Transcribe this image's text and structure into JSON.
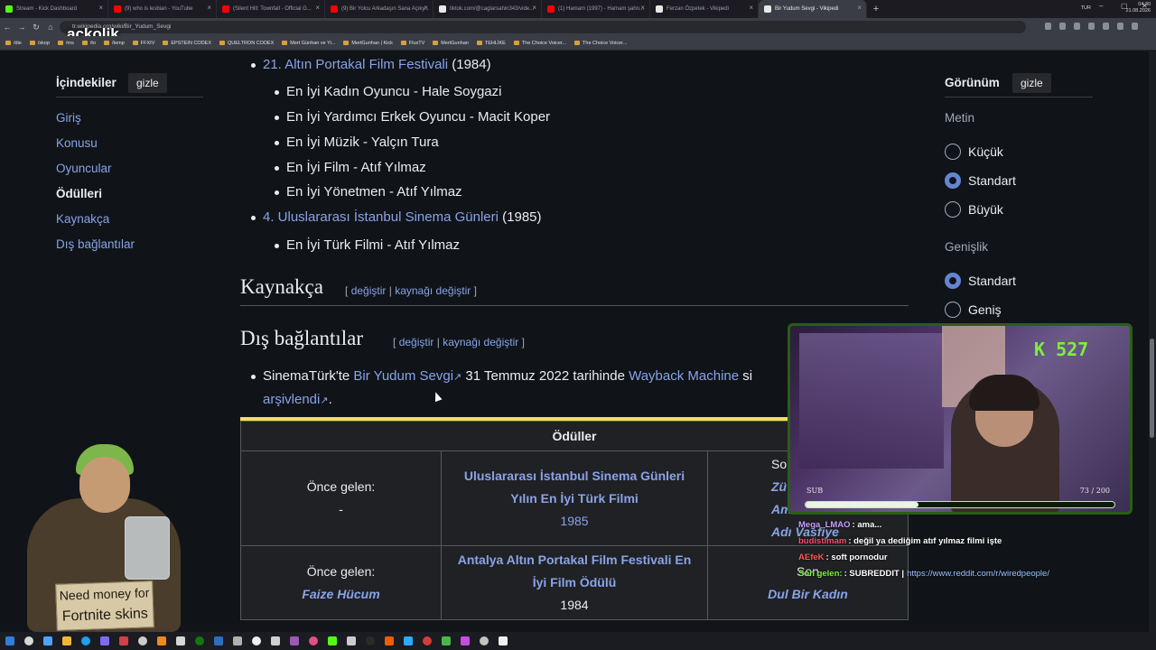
{
  "browser": {
    "tabs": [
      {
        "title": "Stream - Kick Dashboard",
        "color": "#53fc18",
        "active": false
      },
      {
        "title": "(9) who is lesbian - YouTube",
        "color": "#ff0000",
        "active": false
      },
      {
        "title": "(Silent Hill: Townfall - Official G...",
        "color": "#ff0000",
        "active": false
      },
      {
        "title": "(9) Bir Yolcu Arkadaşın Sana Açıky...",
        "color": "#ff0000",
        "active": false
      },
      {
        "title": "tiktok.com/@caglarsahin343/vide...",
        "color": "#e8e8e8",
        "active": false
      },
      {
        "title": "(1) Hamam (1997) - Hamam şahn...",
        "color": "#ff0000",
        "active": false
      },
      {
        "title": "Ferzan Özpetek - Vikipedi",
        "color": "#e8e8e8",
        "active": false
      },
      {
        "title": "Bir Yudum Sevgi - Vikipedi",
        "color": "#e8e8e8",
        "active": true
      }
    ],
    "new_tab": "+",
    "window_controls": [
      "–",
      "▢",
      "✕"
    ],
    "url": "tr.wikipedia.org/wiki/Bir_Yudum_Sevgi",
    "logo_overlay": "ackolik",
    "bookmarks": [
      "/die",
      "/skop",
      "/ms",
      "/to",
      "/temp",
      "FFXIV",
      "EPSTEIN CODEX",
      "QUELTRON CODEX",
      "Mert Günhan ve Yi...",
      "MertGunhan | Kick",
      "FluxTV",
      "MertGunhan",
      "TEHLİKE",
      "The Choice Voicer...",
      "The Choice Voicer..."
    ]
  },
  "toc": {
    "heading": "İçindekiler",
    "hide_label": "gizle",
    "items": [
      "Giriş",
      "Konusu",
      "Oyuncular",
      "Ödülleri",
      "Kaynakça",
      "Dış bağlantılar"
    ],
    "current_index": 3
  },
  "awards_list": {
    "festival1": {
      "name": "21. Altın Portakal Film Festivali",
      "year": "(1984)"
    },
    "festival1_items": [
      "En İyi Kadın Oyuncu - Hale Soygazi",
      "En İyi Yardımcı Erkek Oyuncu - Macit Koper",
      "En İyi Müzik - Yalçın Tura",
      "En İyi Film - Atıf Yılmaz",
      "En İyi Yönetmen - Atıf Yılmaz"
    ],
    "festival2": {
      "name": "4. Uluslararası İstanbul Sinema Günleri",
      "year": "(1985)"
    },
    "festival2_items": [
      "En İyi Türk Filmi - Atıf Yılmaz"
    ]
  },
  "sections": {
    "kaynakca": "Kaynakça",
    "dis_baglantilar": "Dış bağlantılar",
    "edit_open": "[",
    "edit_label": "değiştir",
    "edit_sep": "|",
    "source_edit_label": "kaynağı değiştir",
    "edit_close": "]"
  },
  "external_link": {
    "prefix": "SinemaTürk'te",
    "link_text": "Bir Yudum Sevgi",
    "middle": "31 Temmuz 2022 tarihinde",
    "wayback": "Wayback Machine",
    "suffix_visible": "si",
    "archived": "arşivlendi",
    "tail": "."
  },
  "awards_table": {
    "header": "Ödüller",
    "rows": [
      {
        "prev_label": "Önce gelen:",
        "prev_value": "-",
        "award": "Uluslararası İstanbul Sinema Günleri Yılın En İyi Türk Filmi",
        "year": "1985",
        "next_label": "Son",
        "next_value_1": "Zü",
        "next_value_2": "Am",
        "next_value_3": "Adı Vasfiye"
      },
      {
        "prev_label": "Önce gelen:",
        "prev_value": "Faize Hücum",
        "award": "Antalya Altın Portakal Film Festivali En İyi Film Ödülü",
        "year": "1984",
        "next_label": "Son",
        "next_value": "Dul Bir Kadın"
      }
    ]
  },
  "appearance": {
    "heading": "Görünüm",
    "hide_label": "gizle",
    "text_label": "Metin",
    "text_options": [
      "Küçük",
      "Standart",
      "Büyük"
    ],
    "text_selected": 1,
    "width_label": "Genişlik",
    "width_options": [
      "Standart",
      "Geniş"
    ],
    "width_selected": 0
  },
  "stream_overlay": {
    "counter": "K 527",
    "sub_label": "SUB",
    "sub_count": "73 / 200",
    "sub_progress": 0.365,
    "chat": [
      {
        "user": "Mega_LMAO",
        "user_color": "#c9a0ff",
        "text": ": ama..."
      },
      {
        "user": "budistimam",
        "user_color": "#ff4d6d",
        "text": ": değil ya dediğim atıf yılmaz filmi işte"
      },
      {
        "user": "AEfeK",
        "user_color": "#ff5a5a",
        "text": ": soft pornodur"
      },
      {
        "user": "Son gelen:",
        "user_color": "#7cf03a",
        "text": ": SUBREDDIT |",
        "link": "https://www.reddit.com/r/wiredpeople/"
      }
    ],
    "sign_line1": "Need money for",
    "sign_line2": "Fortnite skins"
  },
  "taskbar": {
    "icon_colors": [
      "#2f7fd8",
      "#d8d8d8",
      "#4fa3f7",
      "#f3b63a",
      "#1ea0f0",
      "#7b6cf0",
      "#d14242",
      "#cccccc",
      "#f08a1c",
      "#d6d6d6",
      "#0e7a0e",
      "#2c6fbf",
      "#b0b0b0",
      "#f0f0f0",
      "#d0d0d0",
      "#9b59b6",
      "#e44d8a",
      "#53fc18",
      "#cccccc",
      "#2a2a2a",
      "#f35b04",
      "#31a8ff",
      "#d63b3b",
      "#49b84a",
      "#c64de3",
      "#c3c3c3",
      "#f0f0f0"
    ],
    "lang": "TUR",
    "time": "04:30",
    "date": "21.08.2026"
  }
}
